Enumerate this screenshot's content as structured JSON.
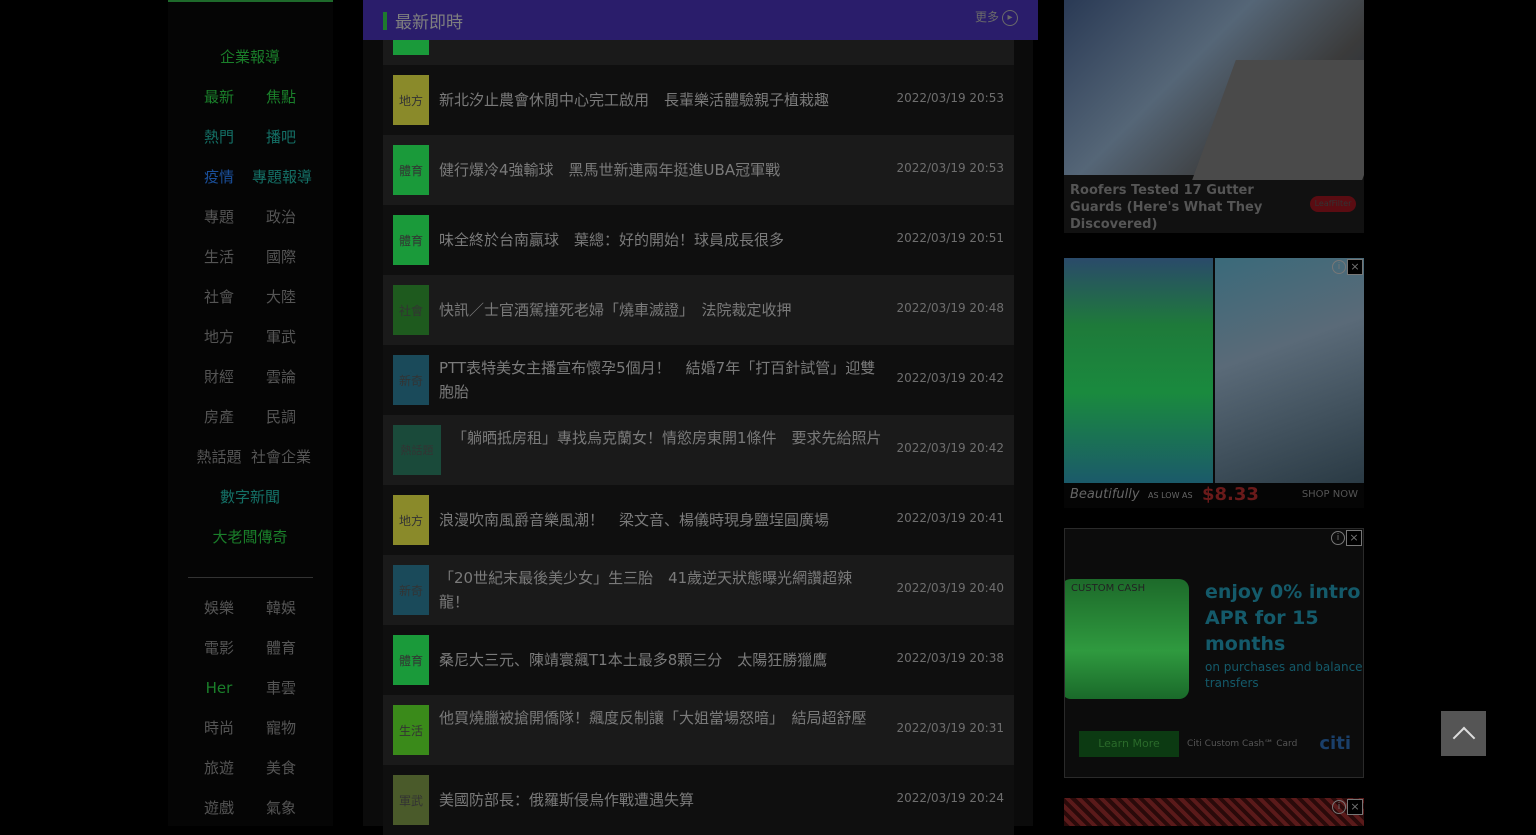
{
  "header": {
    "title": "最新即時",
    "more_label": "更多",
    "more_icon": "▸"
  },
  "sidebar": {
    "items": [
      {
        "label": "企業報導",
        "color": "#1a7f2a"
      },
      {
        "label": "最新",
        "color": "#1a7f2a"
      },
      {
        "label": "焦點",
        "color": "#1a7f2a"
      },
      {
        "label": "熱門",
        "color": "#147066"
      },
      {
        "label": "播吧",
        "color": "#147066"
      },
      {
        "label": "疫情",
        "color": "#1a4f9a"
      },
      {
        "label": "專題報導",
        "color": "#147066"
      },
      {
        "label": "專題",
        "color": "#555555"
      },
      {
        "label": "政治",
        "color": "#555555"
      },
      {
        "label": "生活",
        "color": "#555555"
      },
      {
        "label": "國際",
        "color": "#555555"
      },
      {
        "label": "社會",
        "color": "#555555"
      },
      {
        "label": "大陸",
        "color": "#555555"
      },
      {
        "label": "地方",
        "color": "#555555"
      },
      {
        "label": "軍武",
        "color": "#555555"
      },
      {
        "label": "財經",
        "color": "#555555"
      },
      {
        "label": "雲論",
        "color": "#555555"
      },
      {
        "label": "房產",
        "color": "#555555"
      },
      {
        "label": "民調",
        "color": "#555555"
      },
      {
        "label": "熱話題",
        "color": "#555555"
      },
      {
        "label": "社會企業",
        "color": "#555555"
      },
      {
        "label": "數字新聞",
        "color": "#147066"
      },
      {
        "label": "大老闆傳奇",
        "color": "#1a7f2a"
      },
      {
        "label": "娛樂",
        "color": "#555555"
      },
      {
        "label": "韓娛",
        "color": "#555555"
      },
      {
        "label": "電影",
        "color": "#555555"
      },
      {
        "label": "體育",
        "color": "#555555"
      },
      {
        "label": "Her",
        "color": "#1a7f2a"
      },
      {
        "label": "車雲",
        "color": "#555555"
      },
      {
        "label": "時尚",
        "color": "#555555"
      },
      {
        "label": "寵物",
        "color": "#555555"
      },
      {
        "label": "旅遊",
        "color": "#555555"
      },
      {
        "label": "美食",
        "color": "#555555"
      },
      {
        "label": "遊戲",
        "color": "#555555"
      },
      {
        "label": "氣象",
        "color": "#555555"
      }
    ]
  },
  "news": [
    {
      "tag": "地方",
      "tag_color": "#8a8a2a",
      "title": "新北汐止農會休閒中心完工啟用　長輩樂活體驗親子植栽趣",
      "time": "2022/03/19 20:53"
    },
    {
      "tag": "體育",
      "tag_color": "#1a9a3a",
      "title": "健行爆冷4強輸球　黑馬世新連兩年挺進UBA冠軍戰",
      "time": "2022/03/19 20:53"
    },
    {
      "tag": "體育",
      "tag_color": "#1a9a3a",
      "title": "味全終於台南贏球　葉總：好的開始！球員成長很多",
      "time": "2022/03/19 20:51"
    },
    {
      "tag": "社會",
      "tag_color": "#1e5a1e",
      "title": "快訊／士官酒駕撞死老婦「燒車滅證」　法院裁定收押",
      "time": "2022/03/19 20:48"
    },
    {
      "tag": "新奇",
      "tag_color": "#1a4a5a",
      "title": "PTT表特美女主播宣布懷孕5個月！　結婚7年「打百針試管」迎雙胞胎",
      "time": "2022/03/19 20:42"
    },
    {
      "tag": "熱話題",
      "tag_color": "#1a4a3a",
      "title": "「躺晒抵房租」專找烏克蘭女！情慾房東開1條件　要求先給照片",
      "time": "2022/03/19 20:42"
    },
    {
      "tag": "地方",
      "tag_color": "#8a8a2a",
      "title": "浪漫吹南風爵音樂風潮！　梁文音、楊儀時現身鹽埕圓廣場",
      "time": "2022/03/19 20:41"
    },
    {
      "tag": "新奇",
      "tag_color": "#1a4a5a",
      "title": "「20世紀末最後美少女」生三胎　41歲逆天狀態曝光網讚超辣龍！",
      "time": "2022/03/19 20:40"
    },
    {
      "tag": "體育",
      "tag_color": "#1a9a3a",
      "title": "桑尼大三元、陳靖寰飆T1本土最多8顆三分　太陽狂勝獵鷹",
      "time": "2022/03/19 20:38"
    },
    {
      "tag": "生活",
      "tag_color": "#3a8a1a",
      "title": "他買燒臘被搶開僑隊！飆度反制讓「大姐當場怒暗」　結局超舒壓",
      "time": "2022/03/19 20:31"
    },
    {
      "tag": "軍武",
      "tag_color": "#4a5a2a",
      "title": "美國防部長：俄羅斯侵烏作戰遭遇失算",
      "time": "2022/03/19 20:24"
    }
  ],
  "ads": {
    "ad1": {
      "caption": "Roofers Tested 17 Gutter Guards (Here's What They Discovered)",
      "button": "LeafFilter"
    },
    "ad2": {
      "brand": "Beautifully",
      "as_low_as": "AS LOW AS",
      "price": "$8.33",
      "shop": "SHOP NOW"
    },
    "ad3": {
      "card_label": "CUSTOM CASH",
      "headline": "enjoy 0% intro APR for 15 months",
      "sub": "on purchases and balance transfers",
      "learn": "Learn More",
      "product": "Citi Custom Cash℠ Card",
      "brand": "citi"
    },
    "close_icon": "×",
    "info_icon": "i"
  },
  "back_to_top": {
    "icon": "chevron-up-icon"
  }
}
